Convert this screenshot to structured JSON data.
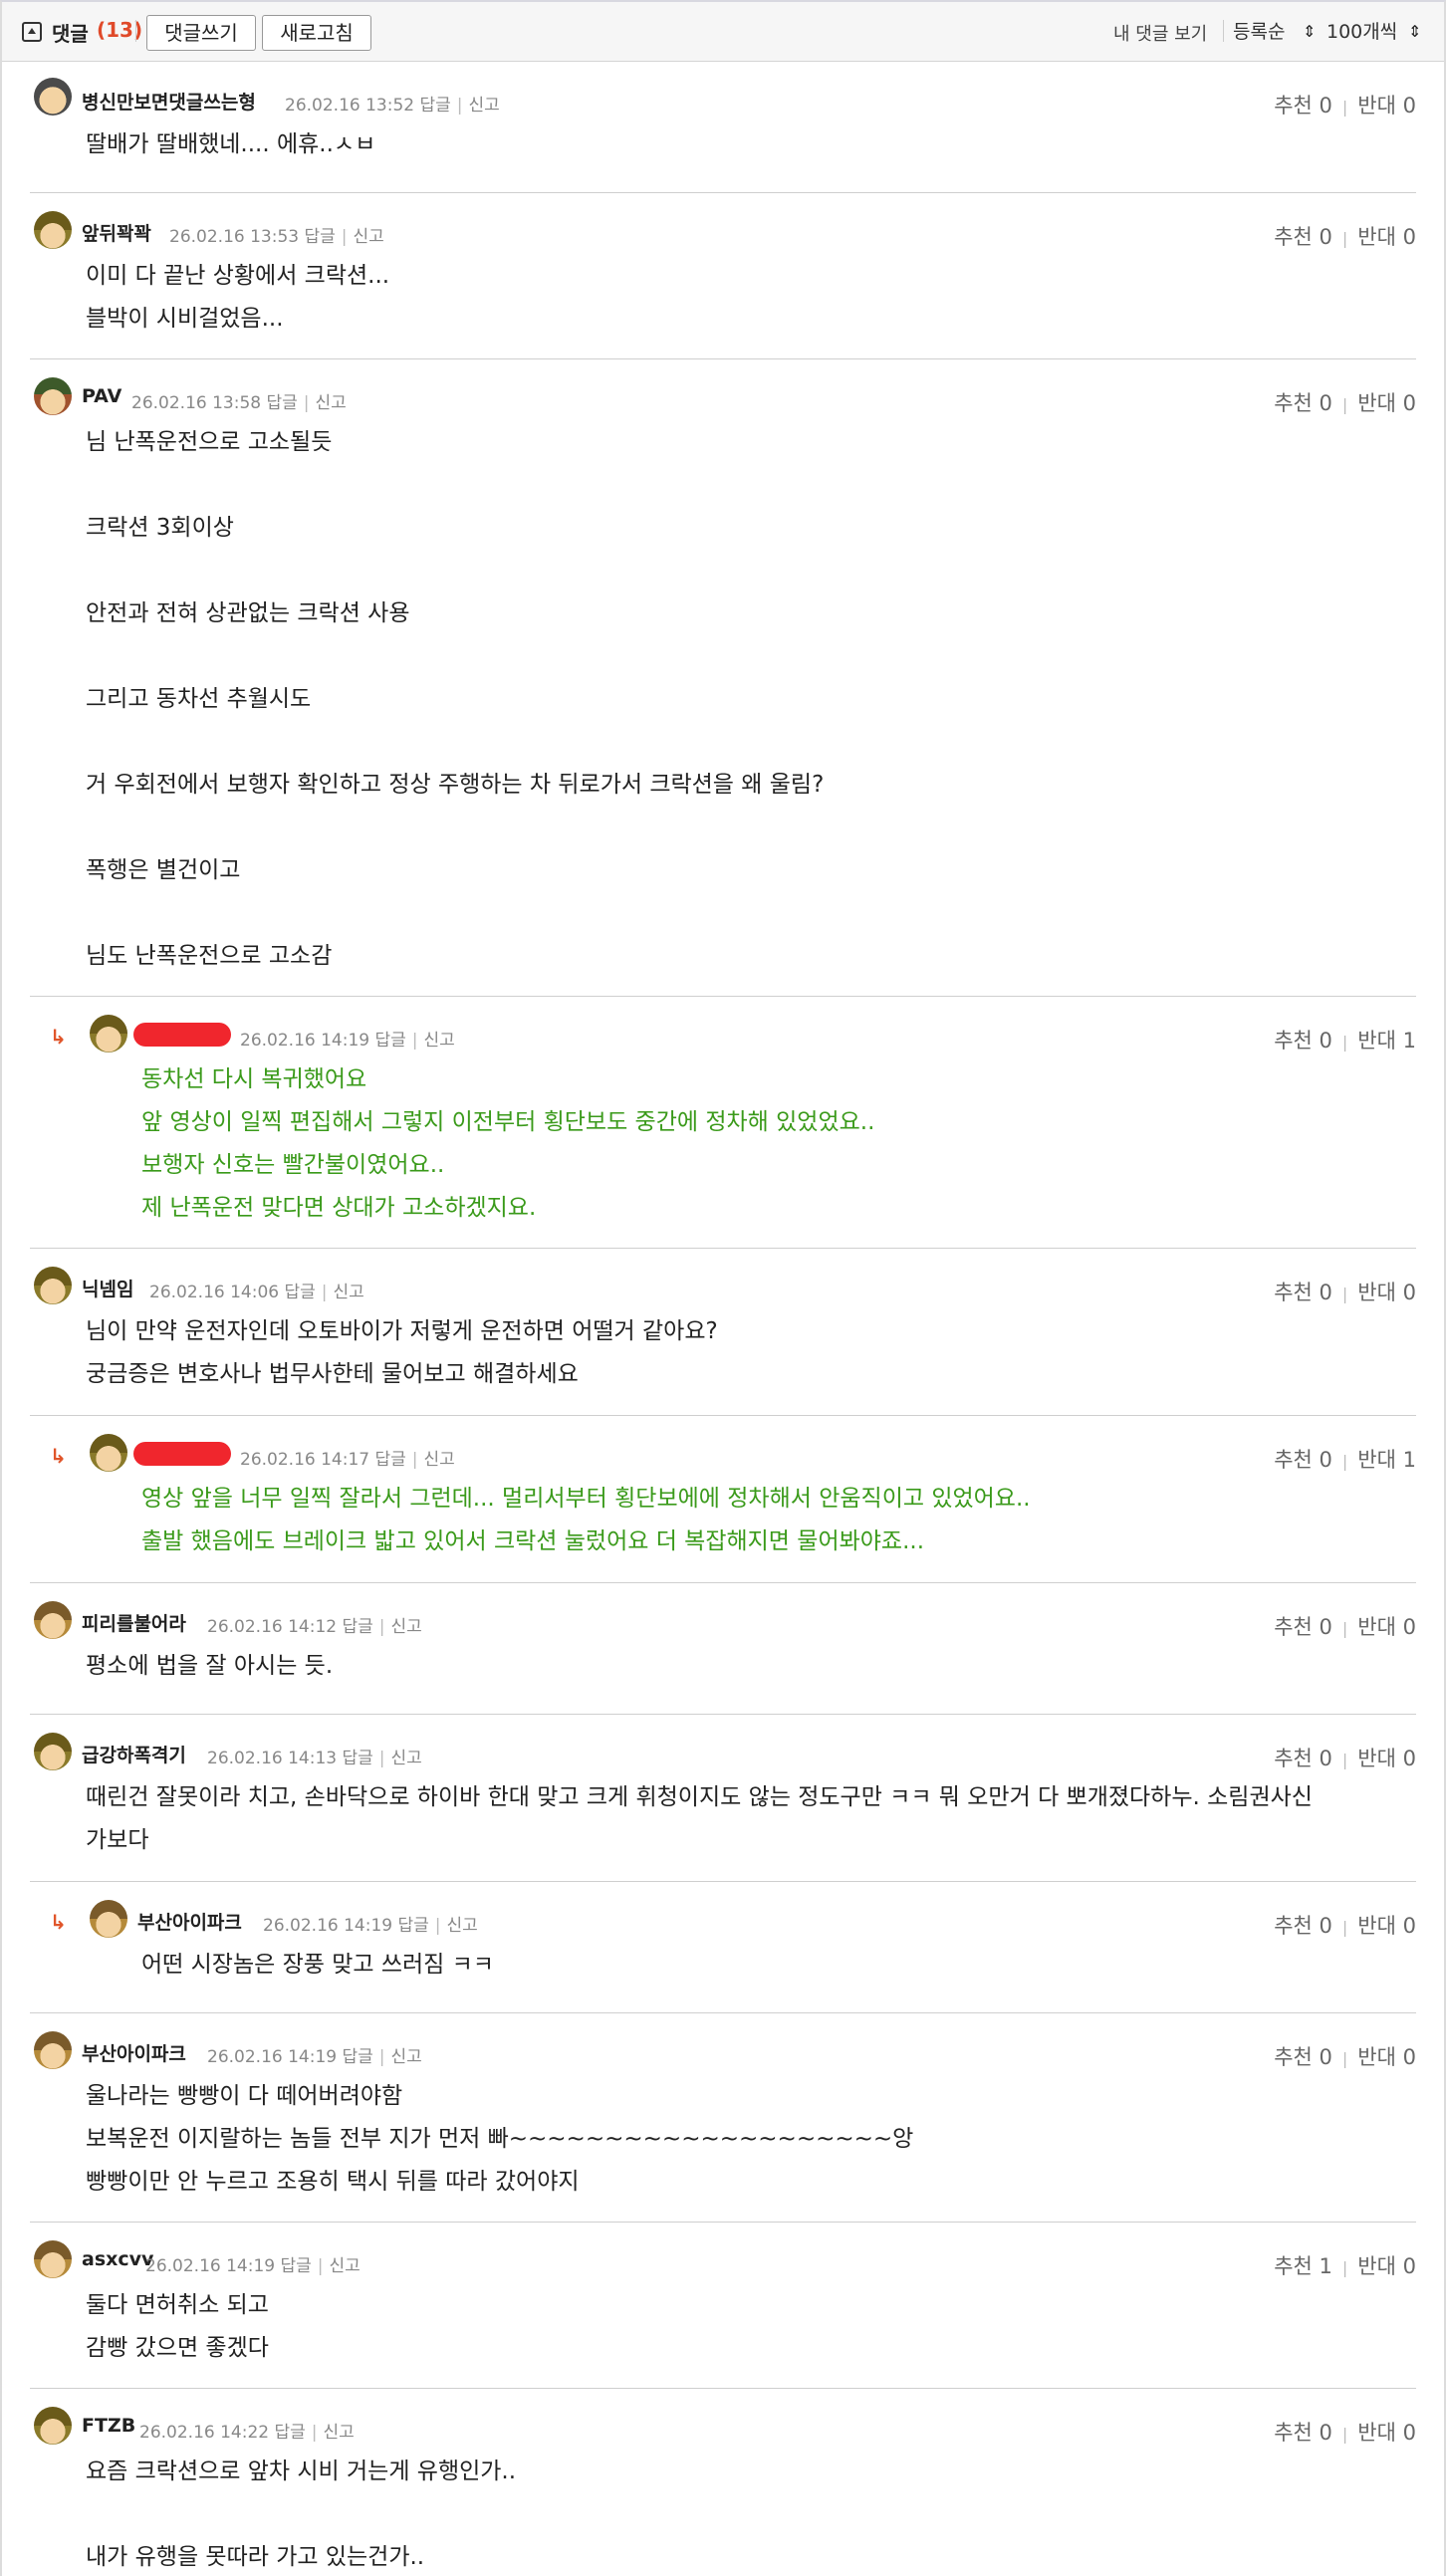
{
  "header": {
    "title": "댓글",
    "count": "(13)",
    "write_button": "댓글쓰기",
    "refresh_button": "새로고침",
    "my_comments": "내 댓글 보기",
    "sort_select": "등록순",
    "page_size_select": "100개씩"
  },
  "colors": {
    "accent_count": "#e04a2a",
    "reply_text": "#3a9a1a",
    "reply_arrow": "#e0552a",
    "redaction": "#f0262d"
  },
  "comments": [
    {
      "nick": "병신만보면댓글쓰는형",
      "date": "26.02.16 13:52",
      "reply": "답글",
      "report": "신고",
      "up_label": "추천",
      "up": "0",
      "down_label": "반대",
      "down": "0",
      "body": "딸배가 딸배했네.... 에휴..ㅅㅂ",
      "avatar": "avatar-icon"
    },
    {
      "nick": "앞뒤꽉꽉",
      "date": "26.02.16 13:53",
      "reply": "답글",
      "report": "신고",
      "up_label": "추천",
      "up": "0",
      "down_label": "반대",
      "down": "0",
      "body": "이미 다 끝난 상황에서 크락션...\n블박이 시비걸었음...",
      "avatar": "avatar-icon"
    },
    {
      "nick": "PAV",
      "date": "26.02.16 13:58",
      "reply": "답글",
      "report": "신고",
      "up_label": "추천",
      "up": "0",
      "down_label": "반대",
      "down": "0",
      "body": "님 난폭운전으로 고소될듯\n\n크락션 3회이상\n\n안전과 전혀 상관없는 크락션 사용\n\n그리고 동차선 추월시도\n\n거 우회전에서 보행자 확인하고 정상 주행하는 차 뒤로가서 크락션을 왜 울림?\n\n폭행은 별건이고\n\n님도 난폭운전으로 고소감",
      "avatar": "avatar-icon"
    },
    {
      "nick": "",
      "date": "26.02.16 14:19",
      "reply": "답글",
      "report": "신고",
      "up_label": "추천",
      "up": "0",
      "down_label": "반대",
      "down": "1",
      "body": "동차선 다시 복귀했어요\n앞 영상이 일찍 편집해서 그렇지 이전부터 횡단보도 중간에 정차해 있었었요..\n보행자 신호는 빨간불이였어요..\n제 난폭운전 맞다면 상대가 고소하겠지요.",
      "avatar": "avatar-icon"
    },
    {
      "nick": "닉넴임",
      "date": "26.02.16 14:06",
      "reply": "답글",
      "report": "신고",
      "up_label": "추천",
      "up": "0",
      "down_label": "반대",
      "down": "0",
      "body": "님이 만약 운전자인데 오토바이가 저렇게 운전하면 어떨거 같아요?\n궁금증은 변호사나 법무사한테 물어보고 해결하세요",
      "avatar": "avatar-icon"
    },
    {
      "nick": "",
      "date": "26.02.16 14:17",
      "reply": "답글",
      "report": "신고",
      "up_label": "추천",
      "up": "0",
      "down_label": "반대",
      "down": "1",
      "body": "영상 앞을 너무 일찍 잘라서 그런데... 멀리서부터 횡단보에에 정차해서 안움직이고 있었어요..\n출발 했음에도 브레이크 밟고 있어서 크락션 눌렀어요 더 복잡해지면 물어봐야죠...",
      "avatar": "avatar-icon"
    },
    {
      "nick": "피리를불어라",
      "date": "26.02.16 14:12",
      "reply": "답글",
      "report": "신고",
      "up_label": "추천",
      "up": "0",
      "down_label": "반대",
      "down": "0",
      "body": "평소에 법을 잘 아시는 듯.",
      "avatar": "avatar-icon"
    },
    {
      "nick": "급강하폭격기",
      "date": "26.02.16 14:13",
      "reply": "답글",
      "report": "신고",
      "up_label": "추천",
      "up": "0",
      "down_label": "반대",
      "down": "0",
      "body": "때린건 잘못이라 치고, 손바닥으로 하이바 한대 맞고 크게 휘청이지도 않는 정도구만 ㅋㅋ 뭐 오만거 다 뽀개졌다하누. 소림권사신\n가보다",
      "avatar": "avatar-icon"
    },
    {
      "nick": "부산아이파크",
      "date": "26.02.16 14:19",
      "reply": "답글",
      "report": "신고",
      "up_label": "추천",
      "up": "0",
      "down_label": "반대",
      "down": "0",
      "body": "어떤 시장놈은 장풍 맞고 쓰러짐 ㅋㅋ",
      "avatar": "avatar-icon"
    },
    {
      "nick": "부산아이파크",
      "date": "26.02.16 14:19",
      "reply": "답글",
      "report": "신고",
      "up_label": "추천",
      "up": "0",
      "down_label": "반대",
      "down": "0",
      "body": "울나라는 빵빵이 다 떼어버려야함\n보복운전 이지랄하는 놈들 전부 지가 먼저 빠~~~~~~~~~~~~~~~~~~~~앙\n빵빵이만 안 누르고 조용히 택시 뒤를 따라 갔어야지",
      "avatar": "avatar-icon"
    },
    {
      "nick": "asxcvv",
      "date": "26.02.16 14:19",
      "reply": "답글",
      "report": "신고",
      "up_label": "추천",
      "up": "1",
      "down_label": "반대",
      "down": "0",
      "body": "둘다 면허취소 되고\n감빵 갔으면 좋겠다",
      "avatar": "avatar-icon"
    },
    {
      "nick": "FTZB",
      "date": "26.02.16 14:22",
      "reply": "답글",
      "report": "신고",
      "up_label": "추천",
      "up": "0",
      "down_label": "반대",
      "down": "0",
      "body": "요즘 크락션으로 앞차 시비 거는게 유행인가..\n\n내가 유행을 못따라 가고 있는건가..",
      "avatar": "avatar-icon"
    }
  ]
}
